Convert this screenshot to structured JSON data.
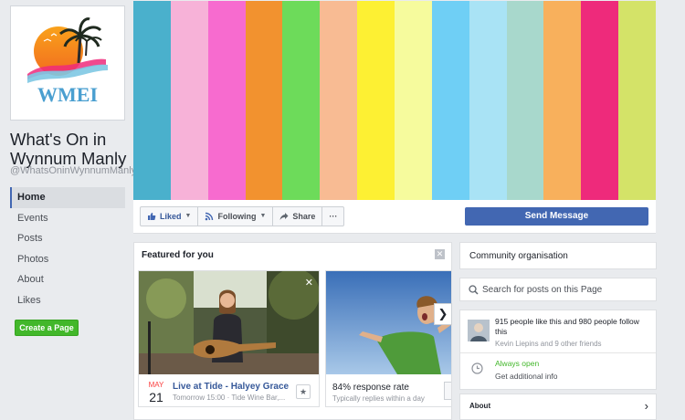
{
  "page": {
    "name": "What's On in Wynnum Manly",
    "handle": "@WhatsOninWynnumManly",
    "logo_text": "WMEI"
  },
  "nav": {
    "items": [
      {
        "label": "Home",
        "active": true
      },
      {
        "label": "Events"
      },
      {
        "label": "Posts"
      },
      {
        "label": "Photos"
      },
      {
        "label": "About"
      },
      {
        "label": "Likes"
      }
    ],
    "create_page_label": "Create a Page"
  },
  "cover": {
    "stripes": [
      "#4ab0cc",
      "#f7b2d8",
      "#f76bcf",
      "#f2922f",
      "#6ddb5a",
      "#f8bb93",
      "#fdf033",
      "#f6fb9d",
      "#6fcff5",
      "#a9e3f5",
      "#a8d8cc",
      "#f8b05c",
      "#ee2a7b",
      "#d4e368"
    ]
  },
  "actions": {
    "liked": "Liked",
    "following": "Following",
    "share": "Share",
    "more": "···",
    "send_message": "Send Message"
  },
  "featured": {
    "title": "Featured for you",
    "event": {
      "month": "MAY",
      "day": "21",
      "title": "Live at Tide - Halyey Grace",
      "subtitle": "Tomorrow 15:00 · Tide Wine Bar,..."
    },
    "response": {
      "title": "84% response rate",
      "subtitle": "Typically replies within a day"
    }
  },
  "sidebar": {
    "category": "Community organisation",
    "search_placeholder": "Search for posts on this Page",
    "likes_text": "915 people like this and 980 people follow this",
    "friends_text": "Kevin Liepins and 9 other friends",
    "open_status": "Always open",
    "info_link": "Get additional info",
    "about_label": "About"
  },
  "colors": {
    "accent": "#4267b2",
    "link": "#365899",
    "green": "#42b72a"
  }
}
